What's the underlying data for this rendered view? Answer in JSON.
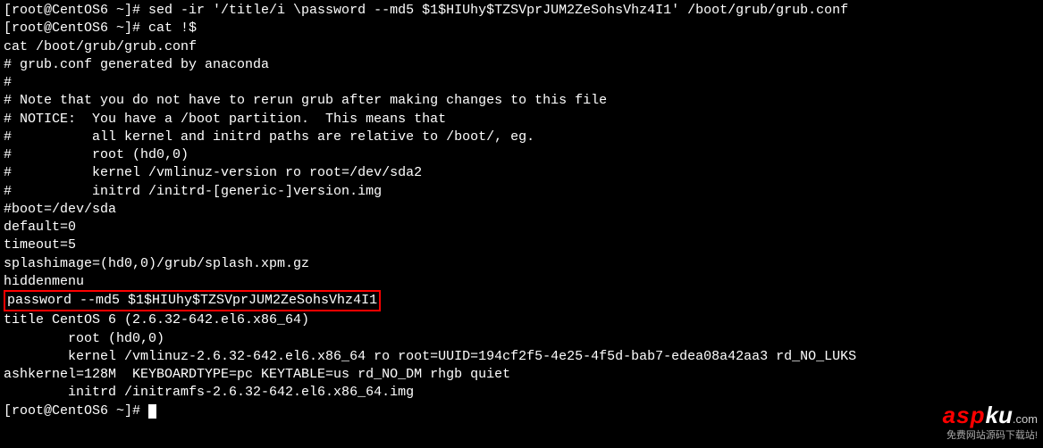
{
  "terminal": {
    "lines": [
      "[root@CentOS6 ~]# sed -ir '/title/i \\password --md5 $1$HIUhy$TZSVprJUM2ZeSohsVhz4I1' /boot/grub/grub.conf",
      "[root@CentOS6 ~]# cat !$",
      "cat /boot/grub/grub.conf",
      "# grub.conf generated by anaconda",
      "#",
      "# Note that you do not have to rerun grub after making changes to this file",
      "# NOTICE:  You have a /boot partition.  This means that",
      "#          all kernel and initrd paths are relative to /boot/, eg.",
      "#          root (hd0,0)",
      "#          kernel /vmlinuz-version ro root=/dev/sda2",
      "#          initrd /initrd-[generic-]version.img",
      "#boot=/dev/sda",
      "default=0",
      "timeout=5",
      "splashimage=(hd0,0)/grub/splash.xpm.gz",
      "hiddenmenu"
    ],
    "highlighted_line": "password --md5 $1$HIUhy$TZSVprJUM2ZeSohsVhz4I1",
    "lines_after": [
      "title CentOS 6 (2.6.32-642.el6.x86_64)",
      "        root (hd0,0)",
      "        kernel /vmlinuz-2.6.32-642.el6.x86_64 ro root=UUID=194cf2f5-4e25-4f5d-bab7-edea08a42aa3 rd_NO_LUKS",
      "ashkernel=128M  KEYBOARDTYPE=pc KEYTABLE=us rd_NO_DM rhgb quiet",
      "        initrd /initramfs-2.6.32-642.el6.x86_64.img"
    ],
    "prompt_final": "[root@CentOS6 ~]# "
  },
  "watermark": {
    "brand_asp": "asp",
    "brand_ku": "ku",
    "brand_com": ".com",
    "tagline": "免费网站源码下载站!"
  }
}
